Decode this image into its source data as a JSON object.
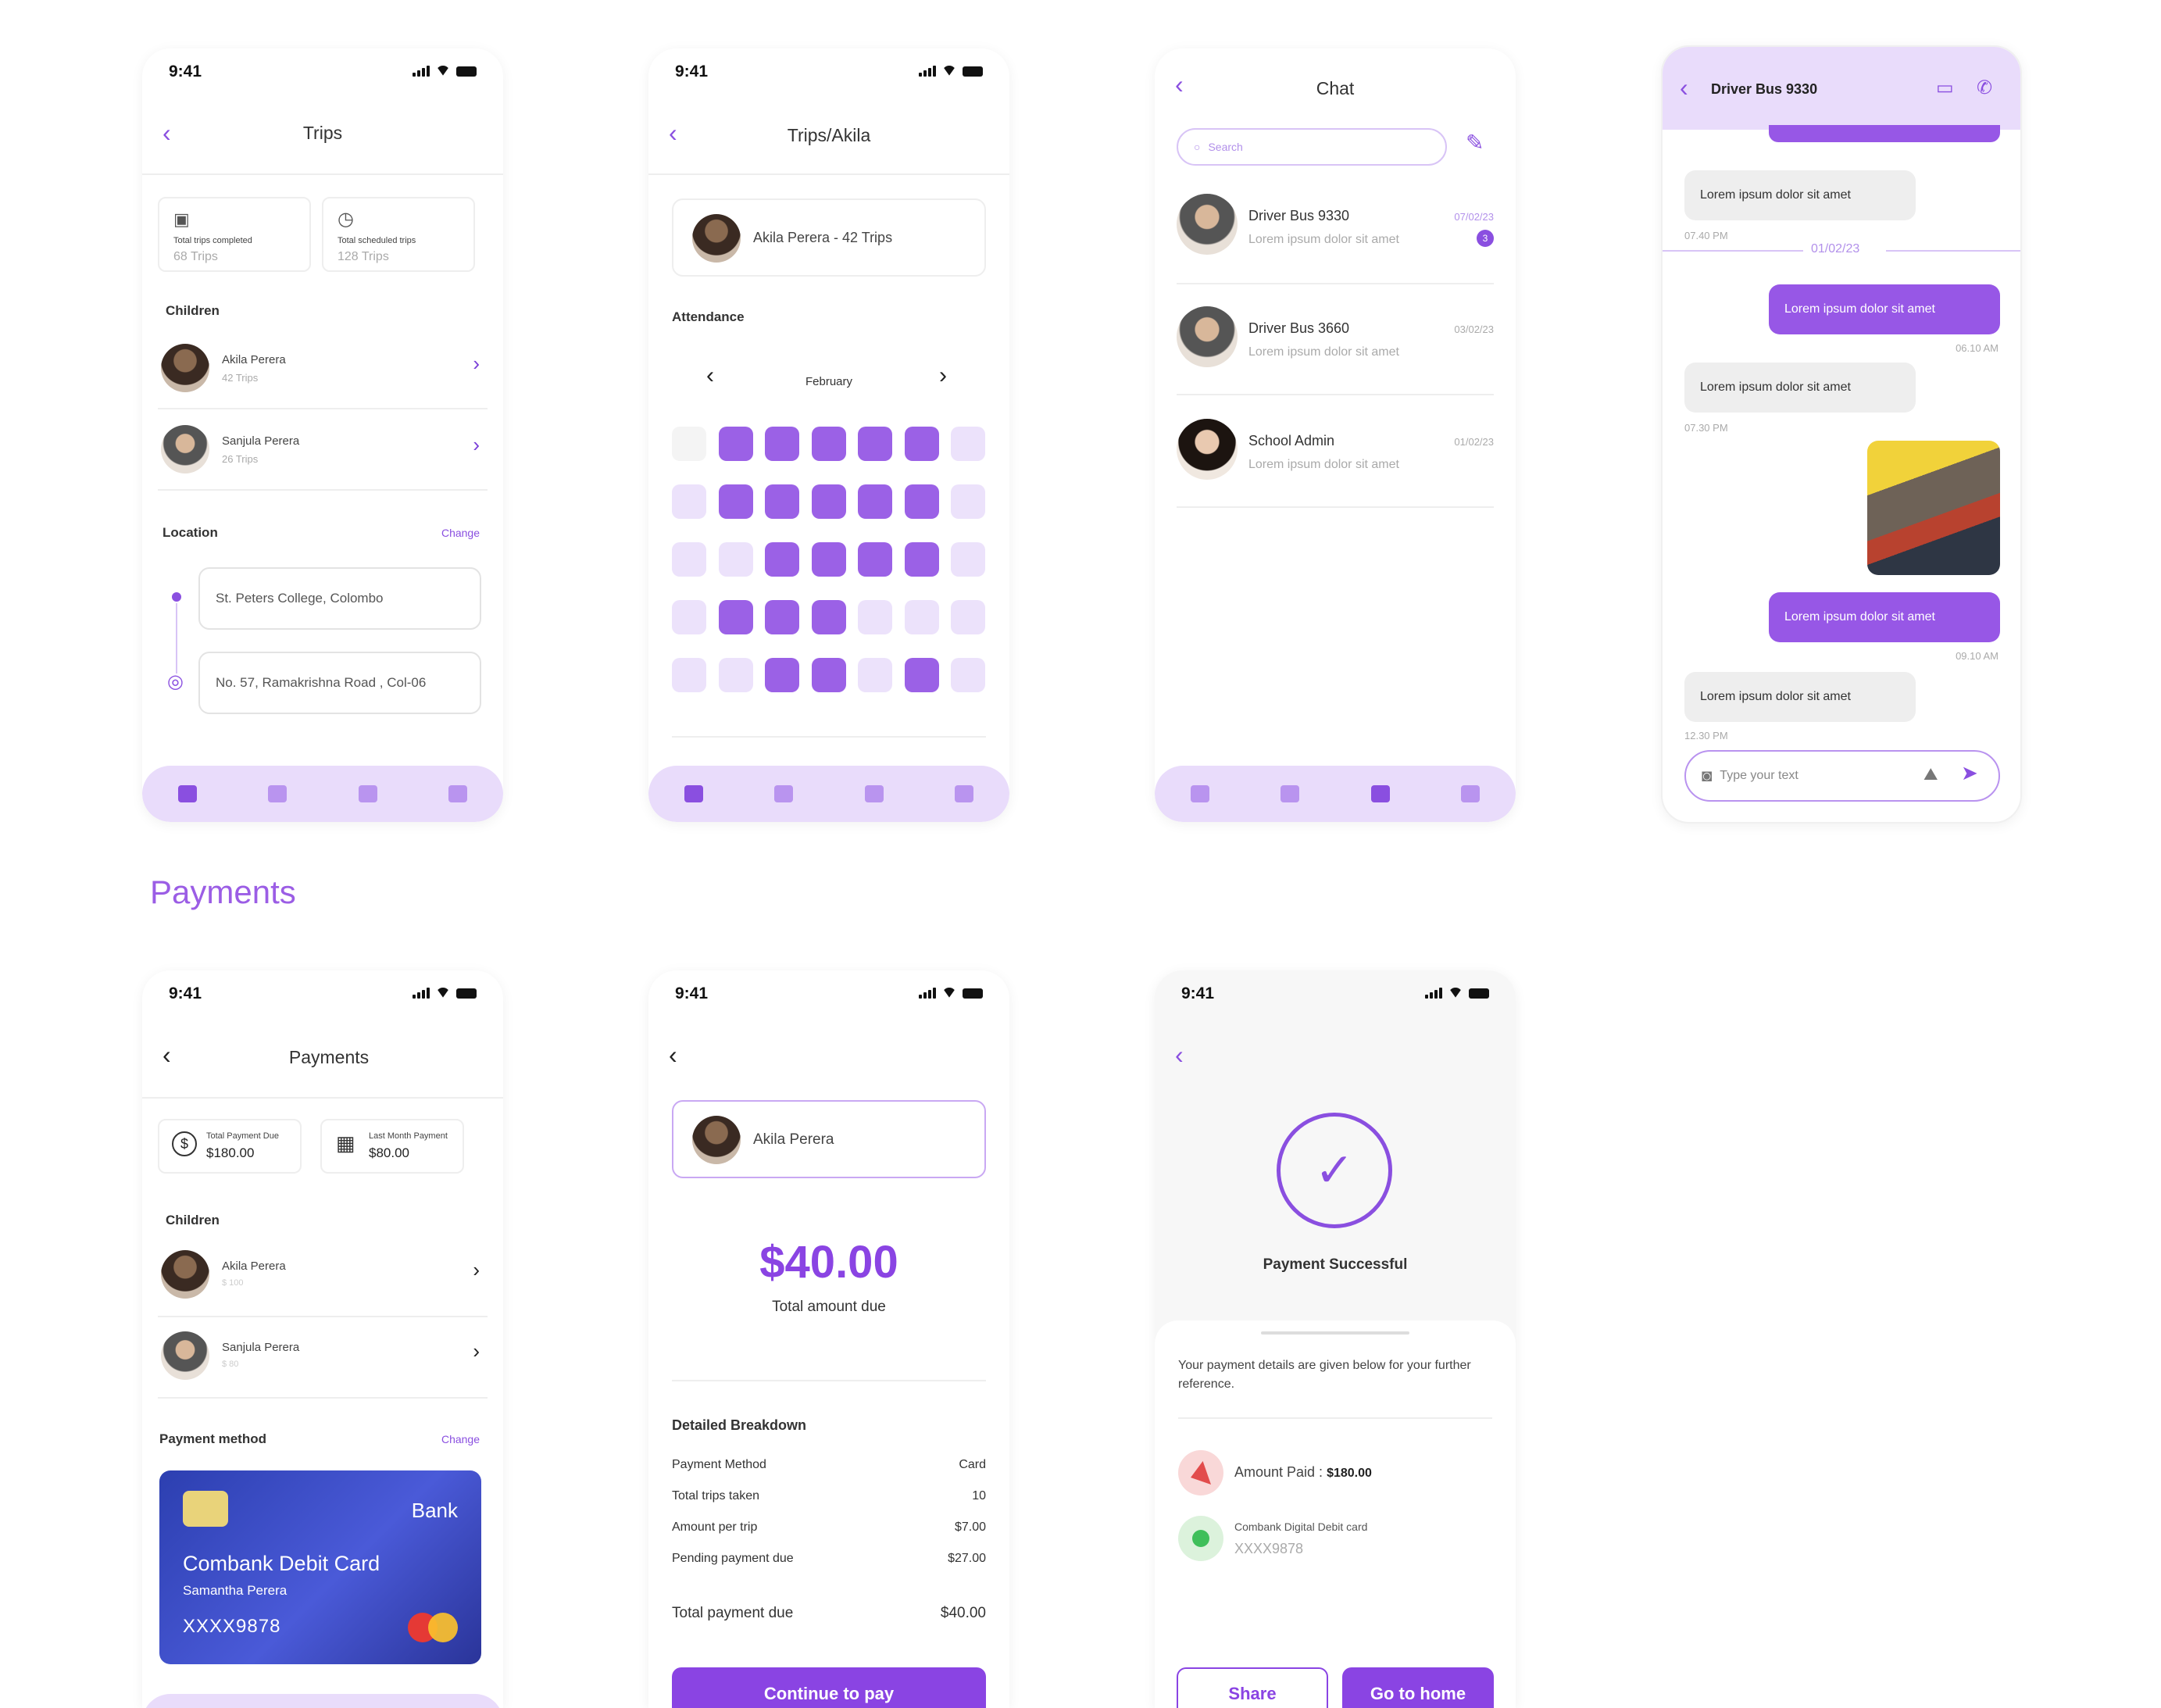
{
  "status_time": "9:41",
  "colors": {
    "accent": "#8a4fe0",
    "light": "#e9dcfb"
  },
  "trips": {
    "title": "Trips",
    "stats": [
      {
        "label": "Total trips completed",
        "value": "68 Trips",
        "icon": "bus-icon"
      },
      {
        "label": "Total scheduled trips",
        "value": "128 Trips",
        "icon": "clock-icon"
      }
    ],
    "children_heading": "Children",
    "children": [
      {
        "name": "Akila Perera",
        "sub": "42 Trips"
      },
      {
        "name": "Sanjula Perera",
        "sub": "26 Trips"
      }
    ],
    "location_heading": "Location",
    "change": "Change",
    "from": "St. Peters College, Colombo",
    "to": "No. 57, Ramakrishna Road , Col-06"
  },
  "attendance": {
    "title": "Trips/Akila",
    "child": "Akila Perera - 42 Trips",
    "heading": "Attendance",
    "month": "February",
    "grid": [
      [
        "w",
        "d",
        "d",
        "d",
        "d",
        "d",
        "l"
      ],
      [
        "l",
        "d",
        "d",
        "d",
        "d",
        "d",
        "l"
      ],
      [
        "l",
        "l",
        "d",
        "d",
        "d",
        "d",
        "l"
      ],
      [
        "l",
        "d",
        "d",
        "d",
        "l",
        "l",
        "l"
      ],
      [
        "l",
        "l",
        "d",
        "d",
        "l",
        "d",
        "l"
      ]
    ]
  },
  "chat": {
    "title": "Chat",
    "search_placeholder": "Search",
    "items": [
      {
        "name": "Driver Bus 9330",
        "msg": "Lorem ipsum dolor sit amet",
        "date": "07/02/23",
        "badge": "3"
      },
      {
        "name": "Driver Bus 3660",
        "msg": "Lorem ipsum dolor sit amet",
        "date": "03/02/23"
      },
      {
        "name": "School Admin",
        "msg": "Lorem ipsum dolor sit amet",
        "date": "01/02/23"
      }
    ]
  },
  "conversation": {
    "title": "Driver Bus 9330",
    "date_divider": "01/02/23",
    "messages": [
      {
        "text": "Lorem ipsum dolor sit amet",
        "time": "07.40 PM"
      },
      {
        "text": "Lorem ipsum dolor sit amet",
        "time": "06.10 AM"
      },
      {
        "text": "Lorem ipsum dolor sit amet",
        "time": "07.30 PM"
      },
      {
        "text": "Lorem ipsum dolor sit amet",
        "time": "09.10 AM"
      },
      {
        "text": "Lorem ipsum dolor sit amet",
        "time": "12.30 PM"
      }
    ],
    "input_placeholder": "Type your text"
  },
  "section_heading": "Payments",
  "payments": {
    "title": "Payments",
    "stats": [
      {
        "label": "Total Payment Due",
        "value": "$180.00"
      },
      {
        "label": "Last Month Payment",
        "value": "$80.00"
      }
    ],
    "children_heading": "Children",
    "children": [
      {
        "name": "Akila Perera",
        "sub": "$ 100"
      },
      {
        "name": "Sanjula Perera",
        "sub": "$ 80"
      }
    ],
    "method_heading": "Payment method",
    "change": "Change",
    "card": {
      "bank": "Bank",
      "name": "Combank Debit Card",
      "holder": "Samantha Perera",
      "number": "XXXX9878"
    }
  },
  "checkout": {
    "child": "Akila Perera",
    "amount": "$40.00",
    "amount_label": "Total amount due",
    "breakdown_heading": "Detailed Breakdown",
    "rows": [
      {
        "k": "Payment Method",
        "v": "Card"
      },
      {
        "k": "Total trips taken",
        "v": "10"
      },
      {
        "k": "Amount per trip",
        "v": "$7.00"
      },
      {
        "k": "Pending payment due",
        "v": "$27.00"
      }
    ],
    "total_label": "Total payment due",
    "total": "$40.00",
    "button": "Continue to pay"
  },
  "success": {
    "title": "Payment Successful",
    "note": "Your payment details are given below for your further reference.",
    "amount_label": "Amount Paid : ",
    "amount_value": "$180.00",
    "card_label": "Combank Digital Debit card",
    "card_number": "XXXX9878",
    "share": "Share",
    "home": "Go to home"
  }
}
